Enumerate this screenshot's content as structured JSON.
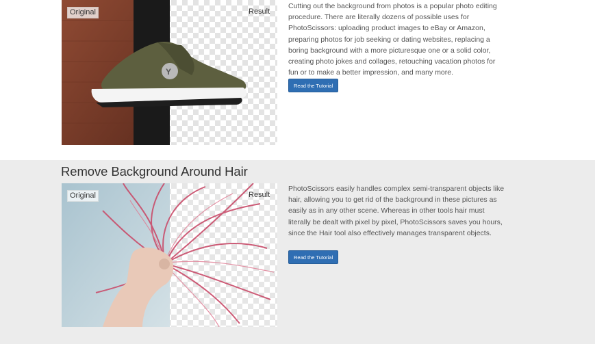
{
  "sections": [
    {
      "image": {
        "original_label": "Original",
        "result_label": "Result"
      },
      "description": "Cutting out the background from photos is a popular photo editing procedure. There are literally dozens of possible uses for PhotoScissors: uploading product images to eBay or Amazon, preparing photos for job seeking or dating websites, replacing a boring background with a more picturesque one or a solid color, creating photo jokes and collages, retouching vacation photos for fun or to make a better impression, and many more.",
      "button_label": "Read the Tutorial"
    },
    {
      "title": "Remove Background Around Hair",
      "image": {
        "original_label": "Original",
        "result_label": "Result"
      },
      "description": "PhotoScissors easily handles complex semi-transparent objects like hair, allowing you to get rid of the background in these pictures as easily as in any other scene. Whereas in other tools hair must literally be dealt with pixel by pixel, PhotoScissors saves you hours, since the Hair tool also effectively manages transparent objects.",
      "button_label": "Read the Tutorial"
    }
  ],
  "colors": {
    "button_bg": "#2f6eb3",
    "section_alt_bg": "#ececec"
  }
}
